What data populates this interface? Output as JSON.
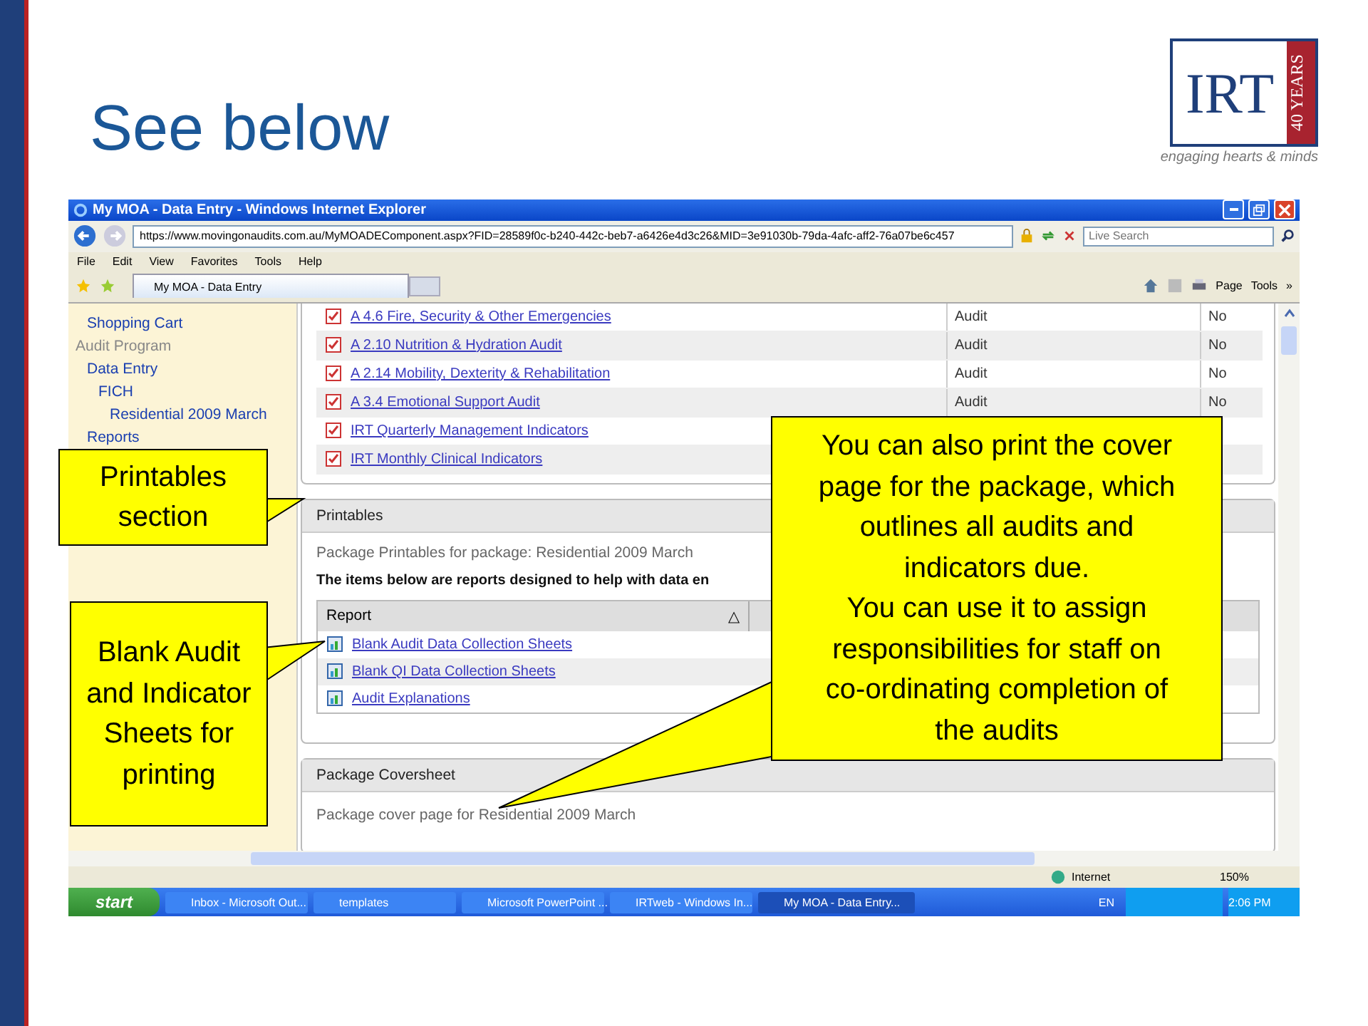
{
  "slide": {
    "title": "See below"
  },
  "logo": {
    "name": "IRT",
    "badge": "40 YEARS",
    "tagline": "engaging hearts & minds"
  },
  "browser": {
    "title": "My MOA - Data Entry - Windows Internet Explorer",
    "url": "https://www.movingonaudits.com.au/MyMOADEComponent.aspx?FID=28589f0c-b240-442c-beb7-a6426e4d3c26&MID=3e91030b-79da-4afc-aff2-76a07be6c457",
    "search": {
      "placeholder": "Live Search"
    },
    "menu": [
      "File",
      "Edit",
      "View",
      "Favorites",
      "Tools",
      "Help"
    ],
    "tab": "My MOA - Data Entry",
    "tools": [
      "Page",
      "Tools",
      "»"
    ]
  },
  "sidebar": {
    "items": [
      {
        "label": "Shopping Cart",
        "kind": "link"
      },
      {
        "label": "Audit Program",
        "kind": "heading",
        "children": [
          {
            "label": "Data Entry",
            "kind": "link",
            "children": [
              {
                "label": "FICH",
                "kind": "link",
                "children": [
                  {
                    "label": "Residential 2009 March",
                    "kind": "link"
                  }
                ]
              }
            ]
          },
          {
            "label": "Reports",
            "kind": "link"
          }
        ]
      }
    ]
  },
  "audits": {
    "rows": [
      {
        "name": "A 4.6 Fire, Security & Other Emergencies",
        "type": "Audit",
        "flag": "No"
      },
      {
        "name": "A 2.10 Nutrition & Hydration Audit",
        "type": "Audit",
        "flag": "No"
      },
      {
        "name": "A 2.14 Mobility, Dexterity & Rehabilitation",
        "type": "Audit",
        "flag": "No"
      },
      {
        "name": "A 3.4 Emotional Support Audit",
        "type": "Audit",
        "flag": "No"
      },
      {
        "name": "IRT Quarterly Management Indicators"
      },
      {
        "name": "IRT Monthly Clinical Indicators"
      }
    ]
  },
  "printables": {
    "header": "Printables",
    "subtitle": "Package Printables for package: Residential 2009 March",
    "note": "The items below are reports designed to help with data en",
    "columns": [
      {
        "label": "Report",
        "sort": "△"
      }
    ],
    "rows": [
      {
        "name": "Blank Audit Data Collection Sheets"
      },
      {
        "name": "Blank QI Data Collection Sheets"
      },
      {
        "name": "Audit Explanations"
      }
    ]
  },
  "coversheet": {
    "header": "Package Coversheet",
    "text": "Package cover page for Residential 2009 March"
  },
  "status_bar": {
    "zone": "Internet",
    "zoom": "150%"
  },
  "taskbar": {
    "start": "start",
    "items": [
      {
        "label": "Inbox - Microsoft Out...",
        "selected": false
      },
      {
        "label": "templates",
        "selected": false
      },
      {
        "label": "Microsoft PowerPoint ...",
        "selected": false
      },
      {
        "label": "IRTweb - Windows In...",
        "selected": false
      },
      {
        "label": "My MOA - Data Entry...",
        "selected": true
      }
    ],
    "language": "EN",
    "clock": "2:06 PM"
  },
  "callouts": [
    {
      "text": "Printables section"
    },
    {
      "text": "Blank Audit and Indicator Sheets for printing"
    },
    {
      "text": "You can also print the cover page for the package, which outlines all audits and indicators due.\nYou can use it to assign responsibilities for staff on co-ordinating completion of the audits"
    }
  ]
}
